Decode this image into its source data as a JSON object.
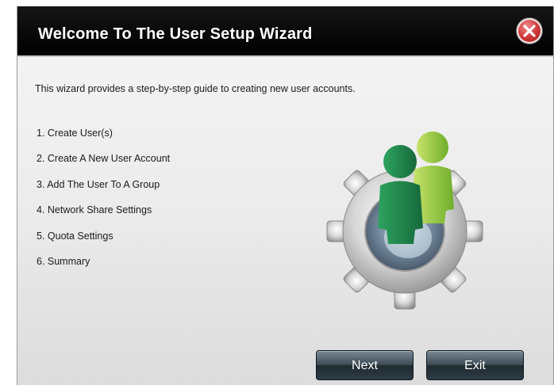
{
  "dialog": {
    "title": "Welcome To The User Setup Wizard",
    "close_icon": "close-icon"
  },
  "content": {
    "intro": "This wizard provides a step-by-step guide to creating new user accounts.",
    "steps": [
      "1. Create User(s)",
      "2. Create A New User Account",
      "3. Add The User To A Group",
      "4. Network Share Settings",
      "5. Quota Settings",
      "6. Summary"
    ],
    "illustration_icon": "users-gear-icon"
  },
  "buttons": {
    "next": "Next",
    "exit": "Exit"
  },
  "colors": {
    "titlebar": "#000000",
    "close": "#d23b3b",
    "user_front": "#1f8a4c",
    "user_back": "#8cc63f",
    "button": "#3d4b55"
  }
}
